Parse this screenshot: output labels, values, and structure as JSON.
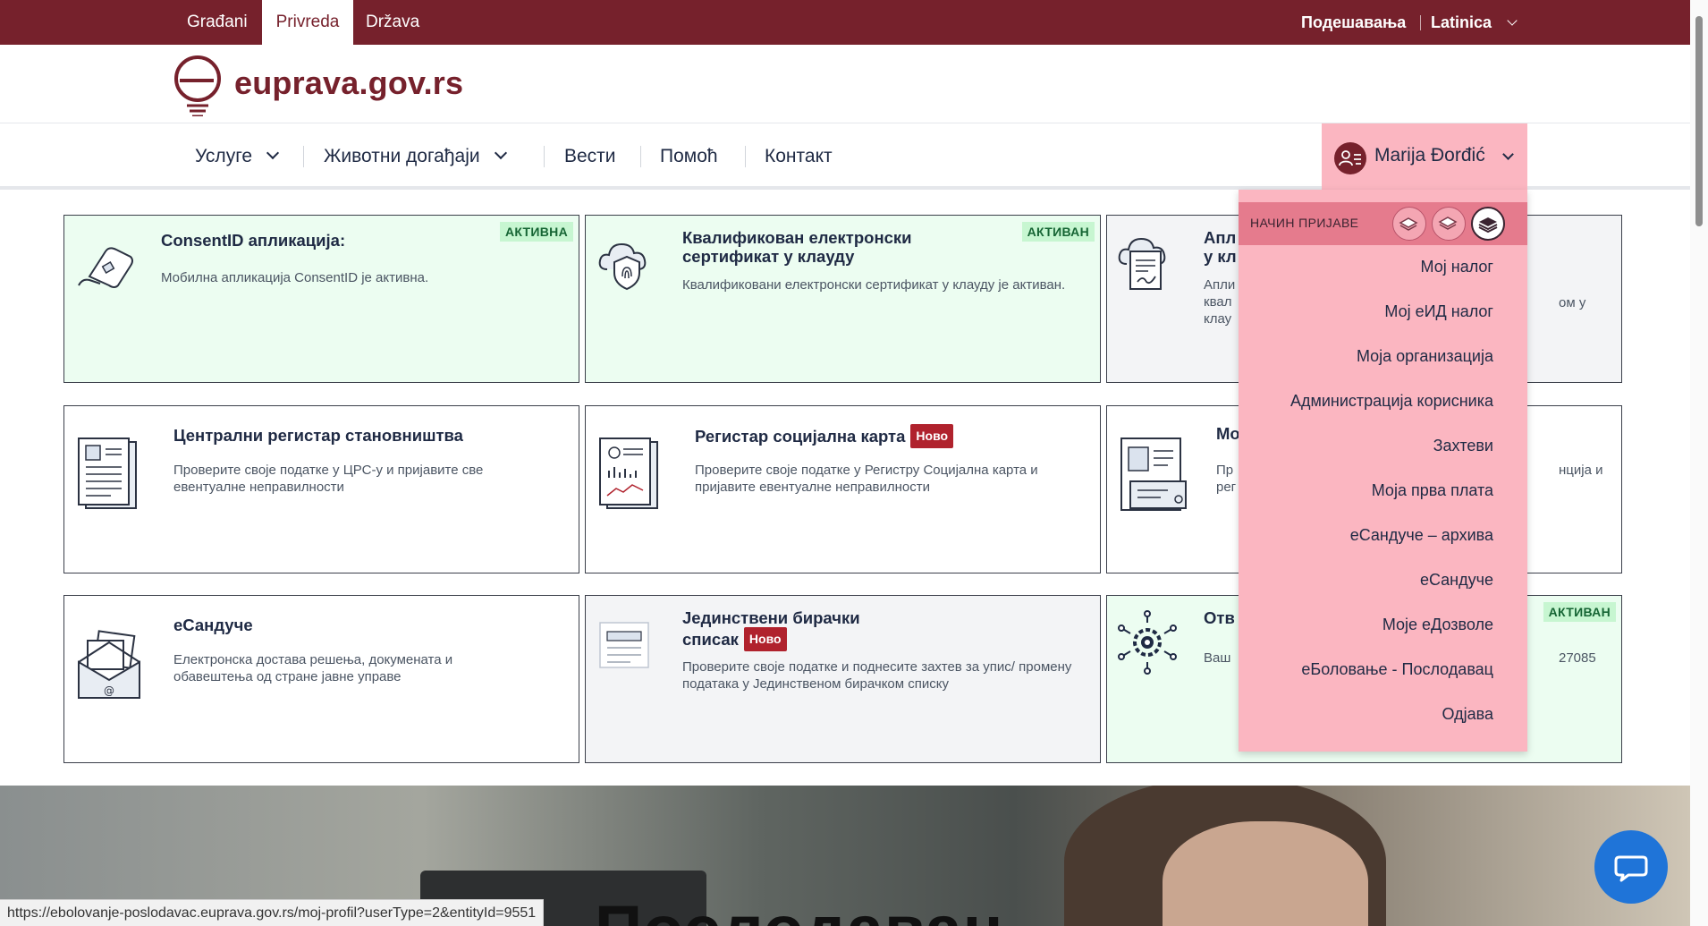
{
  "topbar": {
    "tabs": [
      "Građani",
      "Privreda",
      "Država"
    ],
    "settings": "Подешавања",
    "script": "Latinica"
  },
  "header": {
    "logo_text": "euprava.gov.rs"
  },
  "nav": {
    "items": [
      "Услуге",
      "Животни догађаји",
      "Вести",
      "Помоћ",
      "Контакт"
    ],
    "user_name": "Marija Đorđić"
  },
  "cards": [
    {
      "title": "ConsentID апликација:",
      "desc": "Мобилна апликација ConsentID је активна.",
      "badge": "АКТИВНА"
    },
    {
      "title": "Квалификован електронски сертификат у клауду",
      "desc": "Квалификовани електронски сертификат у клауду је активан.",
      "badge": "АКТИВАН"
    },
    {
      "title_a": "Апл",
      "title_b": "у кл",
      "desc_a": "Апли",
      "desc_b": "квал",
      "desc_c": "клау",
      "desc_right": "ом у"
    },
    {
      "title": "Централни регистар становништва",
      "desc": "Проверите своје податке у ЦРС-у и пријавите све евентуалне неправилности"
    },
    {
      "title": "Регистар социјална карта",
      "new": "Ново",
      "desc": "Проверите своје податке у Регистру Социјална карта и пријавите евентуалне неправилности"
    },
    {
      "title": "Мо",
      "desc_a": "Пр",
      "desc_b": "рег",
      "desc_right": "нција и"
    },
    {
      "title": "еСандуче",
      "desc": "Електронска достава решења, докумената и обавештења од стране јавне управе"
    },
    {
      "title_a": "Јединствени бирачки",
      "title_b": "списак",
      "new": "Ново",
      "desc": "Проверите своје податке и поднесите захтев за упис/ промену података у Јединственом бирачком списку"
    },
    {
      "title": "Отв",
      "desc": "Ваш",
      "desc_right": "27085",
      "badge": "АКТИВАН"
    }
  ],
  "dropdown": {
    "login_mode_label": "НАЧИН ПРИЈАВЕ",
    "items": [
      "Мој налог",
      "Мој еИД налог",
      "Моја организација",
      "Администрација корисника",
      "Захтеви",
      "Моја прва плата",
      "еСандуче – архива",
      "еСандуче",
      "Моје еДозволе",
      "еБоловање - Послодавац",
      "Одјава"
    ]
  },
  "hero": {
    "title": "Послодавац"
  },
  "status_url": "https://ebolovanje-poslodavac.euprava.gov.rs/moj-profil?userType=2&entityId=9551",
  "colors": {
    "brand": "#76212c",
    "menu_pink": "#fbb6c1",
    "menu_header": "#e57b8d",
    "active_green": "#c7f6d1",
    "chat_blue": "#1f74d8"
  }
}
